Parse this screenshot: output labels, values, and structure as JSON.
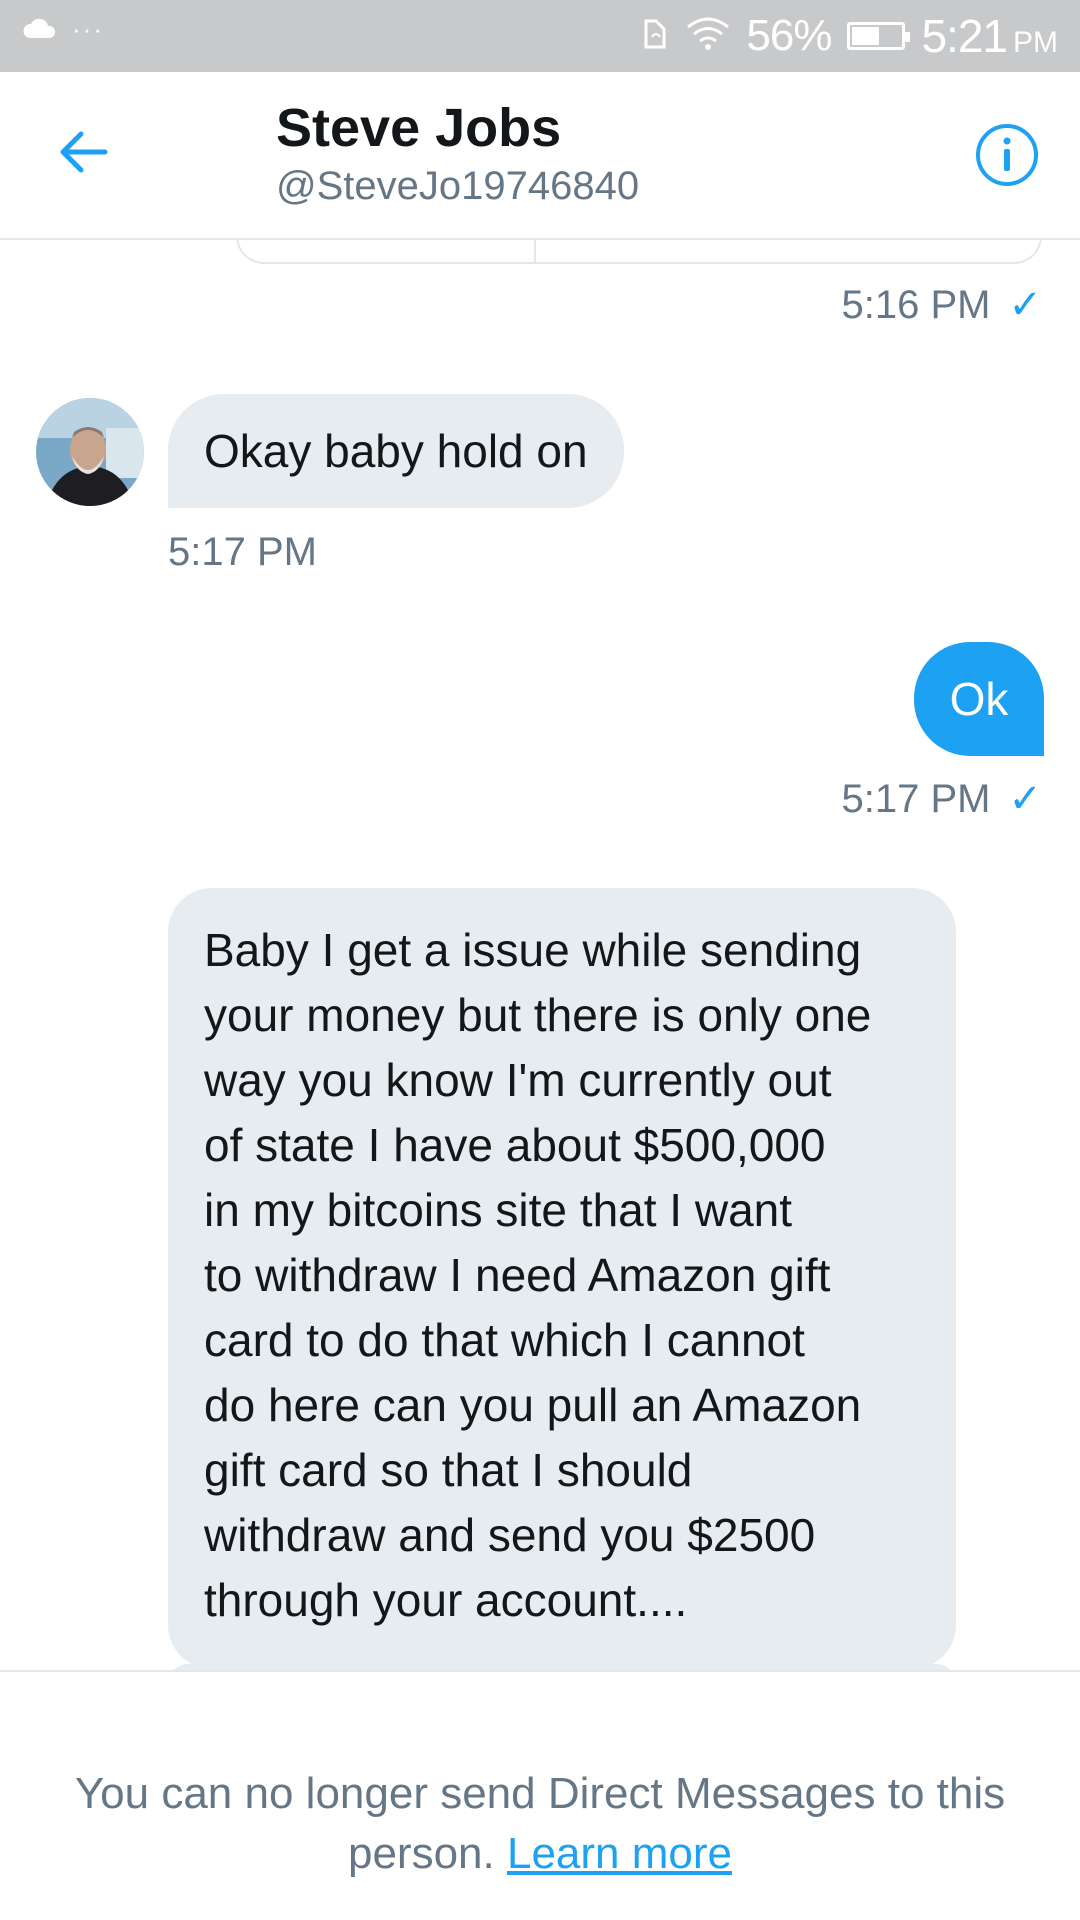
{
  "status_bar": {
    "battery_percent": "56%",
    "battery_level": 0.56,
    "time": "5:21",
    "ampm": "PM",
    "icons": [
      "cloud-icon",
      "more-dots-icon",
      "nfc-icon",
      "wifi-icon",
      "battery-icon"
    ]
  },
  "header": {
    "name": "Steve Jobs",
    "handle": "@SteveJo19746840",
    "back_icon": "back-arrow-icon",
    "info_icon": "info-icon"
  },
  "messages": [
    {
      "direction": "out",
      "text": "",
      "time": "5:16 PM",
      "seen": true
    },
    {
      "direction": "in",
      "text": "Okay baby hold on",
      "time": "5:17 PM"
    },
    {
      "direction": "out",
      "text": "Ok",
      "time": "5:17 PM",
      "seen": true
    },
    {
      "direction": "in",
      "text": "Baby I get a issue while sending your money but there is only one way you know I'm currently out of state I have about $500,000 in my bitcoins site that I want to withdraw  I need Amazon gift card to do that which I cannot do here  can you pull an Amazon gift card  so that I should withdraw and send you $2500 through your account...."
    }
  ],
  "message_display_lines": "Baby I get a issue while sending\nyour money but there is only one\nway you know I'm currently out\nof state I have about $500,000\nin my bitcoins site that I want\nto withdraw  I need Amazon gift\ncard to do that which I cannot\ndo here  can you pull an Amazon\ngift card  so that I should\nwithdraw and send you $2500\nthrough your account....",
  "check_mark": "✓",
  "footer": {
    "notice": "You can no longer send Direct Messages to this person.",
    "link": "Learn more"
  },
  "colors": {
    "accent": "#1da1f2",
    "bubble_in": "#e6ecf0",
    "muted_text": "#657786",
    "status_bar": "#c8c9cb"
  }
}
